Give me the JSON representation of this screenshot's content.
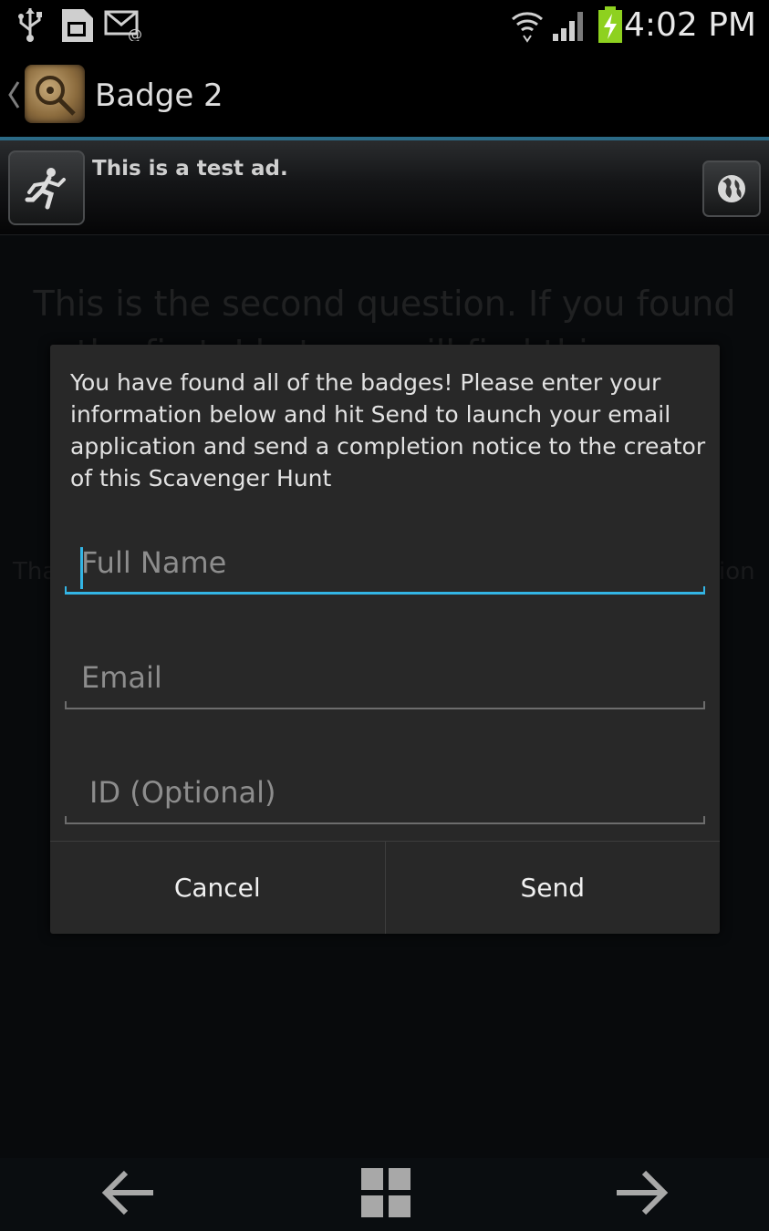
{
  "status_bar": {
    "time": "4:02 PM",
    "icons": [
      "usb-icon",
      "sd-card-icon",
      "email-icon",
      "wifi-icon",
      "signal-icon",
      "battery-charging-icon"
    ],
    "battery_color": "#8ed11f"
  },
  "action_bar": {
    "title": "Badge 2",
    "accent_color": "#2b6a86"
  },
  "ad": {
    "text": "This is a test ad."
  },
  "background": {
    "question": "This is the second question.  If you found the first, I bet you will find this one.",
    "left_text": "Tha",
    "right_text": "ion"
  },
  "dialog": {
    "message": "You have found all of the badges!  Please enter your information below and hit Send to launch your email application and send a completion notice to the creator of this Scavenger Hunt",
    "fields": [
      {
        "placeholder": "Full Name",
        "value": "",
        "focused": true
      },
      {
        "placeholder": "Email",
        "value": "",
        "focused": false
      },
      {
        "placeholder": "ID (Optional)",
        "value": "",
        "focused": false
      }
    ],
    "buttons": {
      "cancel": "Cancel",
      "send": "Send"
    },
    "focus_color": "#33b5e5"
  },
  "bottom_nav": {
    "icons": [
      "arrow-left-icon",
      "grid-icon",
      "arrow-right-icon"
    ]
  }
}
